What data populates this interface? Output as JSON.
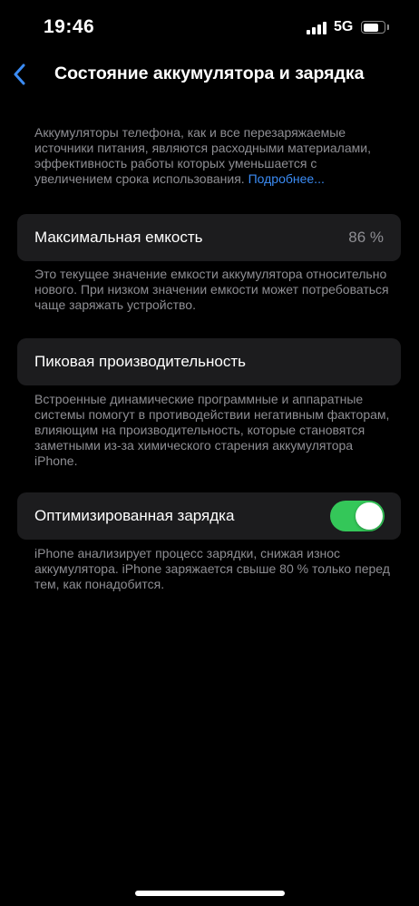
{
  "status_bar": {
    "time": "19:46",
    "network": "5G",
    "battery_level": 0.75
  },
  "nav": {
    "title": "Состояние аккумулятора и зарядка"
  },
  "intro": {
    "text": "Аккумуляторы телефона, как и все перезаряжаемые источники питания, являются расходными материалами, эффективность работы которых уменьшается с увеличением срока использования. ",
    "link": "Подробнее..."
  },
  "max_capacity": {
    "label": "Максимальная емкость",
    "value": "86 %",
    "footer": "Это текущее значение емкости аккумулятора относительно нового. При низком значении емкости может потребоваться чаще заряжать устройство."
  },
  "peak_performance": {
    "label": "Пиковая производительность",
    "footer": "Встроенные динамические программные и аппаратные системы помогут в противодействии негативным факторам, влияющим на производительность, которые становятся заметными из-за химического старения аккумулятора iPhone."
  },
  "optimized_charging": {
    "label": "Оптимизированная зарядка",
    "enabled": true,
    "footer": "iPhone анализирует процесс зарядки, снижая износ аккумулятора. iPhone заряжается свыше 80 % только перед тем, как понадобится."
  },
  "colors": {
    "background": "#000000",
    "cell": "#1c1c1e",
    "secondary_text": "#8e8e93",
    "accent": "#3b8cf5",
    "toggle_on": "#34c759"
  }
}
